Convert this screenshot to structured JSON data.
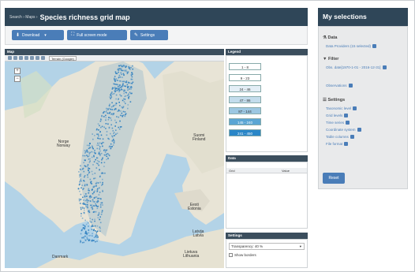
{
  "header": {
    "breadcrumb": "Search › Maps ›",
    "title": "Species richness grid map"
  },
  "toolbar": {
    "download_label": "Download",
    "download_icon": "download-icon",
    "fullscreen_label": "Full screen mode",
    "fullscreen_icon": "expand-icon",
    "settings_label": "Settings",
    "settings_icon": "wrench-icon"
  },
  "map": {
    "panel_title": "Map",
    "layer_select": "Terrain (Google)",
    "zoom_in": "+",
    "zoom_out": "−",
    "labels": {
      "norway": "Norge\nNorway",
      "finland": "Suomi\nFinland",
      "estonia": "Eesti\nEstonia",
      "latvia": "Latvija\nLatvia",
      "lithuania": "Lietuva\nLithuania",
      "denmark": "Danmark"
    },
    "colors": {
      "sea": "#b3d3e7",
      "land": "#e8e4d6",
      "dots": "#2d7fc0"
    }
  },
  "legend": {
    "panel_title": "Legend",
    "items": [
      {
        "label": "1 - 8",
        "color": "#ffffff"
      },
      {
        "label": "9 - 23",
        "color": "#ffffff"
      },
      {
        "label": "24 - 46",
        "color": "#e3eef6"
      },
      {
        "label": "47 - 86",
        "color": "#c3dcec"
      },
      {
        "label": "87 - 144",
        "color": "#9cc7e2"
      },
      {
        "label": "145 - 240",
        "color": "#5aa5d4"
      },
      {
        "label": "241 - 450",
        "color": "#2a86c8"
      }
    ]
  },
  "data": {
    "panel_title": "Data",
    "col1": "Grid",
    "col2": "Value"
  },
  "settings_panel": {
    "panel_title": "Settings",
    "transparency": "Transparency: 40 %",
    "show_borders": "Show borders"
  },
  "sidebar": {
    "title": "My selections",
    "data_heading": "Data",
    "data_link": "Data Providers (15 selected)",
    "filter_heading": "Filter",
    "filter_link": "Obs. date[1970-1-01 - 2016-12-31]",
    "filter_link2": "Observations",
    "settings_heading": "Settings",
    "settings_links": [
      "Taxonomic level",
      "Grid levels",
      "Time series",
      "Coordinate system",
      "Table columns",
      "File format"
    ],
    "reset_label": "Reset"
  }
}
